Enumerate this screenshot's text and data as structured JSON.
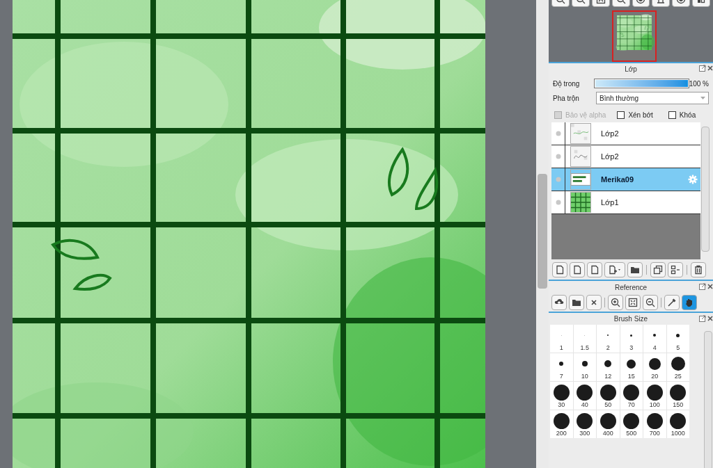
{
  "navigator": {
    "tools": [
      {
        "kind": "zoom-in"
      },
      {
        "kind": "zoom-in"
      },
      {
        "kind": "fit"
      },
      {
        "kind": "zoom-out"
      },
      {
        "kind": "rotate"
      },
      {
        "kind": "flip"
      },
      {
        "kind": "rotate"
      },
      {
        "kind": "split"
      }
    ]
  },
  "layer_panel": {
    "title": "Lớp",
    "opacity": {
      "label": "Độ trong",
      "level": 1,
      "reading": "100 %"
    },
    "blend": {
      "label": "Pha trộn",
      "value": "Bình thường"
    },
    "options": [
      {
        "label": "Bảo vệ alpha",
        "checked": false,
        "disabled": true
      },
      {
        "label": "Xén bớt",
        "checked": false,
        "disabled": false
      },
      {
        "label": "Khóa",
        "checked": false,
        "disabled": false
      }
    ],
    "layers": [
      {
        "name": "Lớp2",
        "kind": "sketch",
        "selected": false
      },
      {
        "name": "Lớp2",
        "kind": "lettering",
        "selected": false
      },
      {
        "name": "Merika09",
        "kind": "text",
        "selected": true
      },
      {
        "name": "Lớp1",
        "kind": "grid",
        "selected": false
      }
    ],
    "tools": [
      {
        "kind": "new-layer"
      },
      {
        "kind": "new-layer"
      },
      {
        "kind": "new-layer"
      },
      {
        "kind": "add"
      },
      {
        "kind": "folder"
      },
      {
        "kind": "copy"
      },
      {
        "kind": "merge"
      },
      {
        "kind": "delete"
      }
    ]
  },
  "reference_panel": {
    "title": "Reference",
    "tools": [
      {
        "kind": "upload",
        "selected": false
      },
      {
        "kind": "folder",
        "selected": false
      },
      {
        "kind": "close",
        "selected": false
      },
      {
        "kind": "zoom-in",
        "selected": false
      },
      {
        "kind": "fit",
        "selected": false
      },
      {
        "kind": "zoom-out",
        "selected": false
      },
      {
        "kind": "eyedropper",
        "selected": false
      },
      {
        "kind": "hand",
        "selected": true
      }
    ]
  },
  "brush_size_panel": {
    "title": "Brush Size",
    "sizes": [
      "1",
      "1.5",
      "2",
      "3",
      "4",
      "5",
      "7",
      "10",
      "12",
      "15",
      "20",
      "25",
      "30",
      "40",
      "50",
      "70",
      "100",
      "150",
      "200",
      "300",
      "400",
      "500",
      "700",
      "1000"
    ]
  }
}
